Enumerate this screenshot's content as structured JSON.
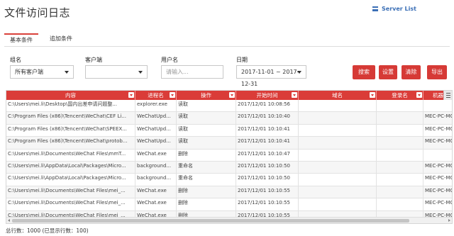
{
  "page": {
    "title": "文件访问日志",
    "server_list": "Server List"
  },
  "tabs": [
    {
      "label": "基本条件"
    },
    {
      "label": "追加条件"
    }
  ],
  "filters": {
    "group": {
      "label": "组名",
      "value": "所有客户端"
    },
    "client": {
      "label": "客户端",
      "value": ""
    },
    "user": {
      "label": "用户名",
      "placeholder": "请输入..."
    },
    "date": {
      "label": "日期",
      "value": "2017-11-01 ~ 2017-12-31"
    }
  },
  "buttons": {
    "search": "搜索",
    "settings": "设置",
    "clear": "清除",
    "export": "导出"
  },
  "table": {
    "columns": [
      "内容",
      "进程名",
      "操作",
      "开始时间",
      "域名",
      "登录名",
      "机器"
    ],
    "rows": [
      [
        "C:\\Users\\mei.li\\Desktop\\国内出差申请问题整...",
        "explorer.exe",
        "读取",
        "2017/12/01 10:08:56",
        "",
        "",
        ""
      ],
      [
        "C:\\Program Files (x86)\\Tencent\\WeChat\\CEF Li...",
        "WeChatUpd...",
        "读取",
        "2017/12/01 10:10:40",
        "",
        "",
        "MEC-PC-MC"
      ],
      [
        "C:\\Program Files (x86)\\Tencent\\WeChat\\SPEEX...",
        "WeChatUpd...",
        "读取",
        "2017/12/01 10:10:41",
        "",
        "",
        "MEC-PC-MC"
      ],
      [
        "C:\\Program Files (x86)\\Tencent\\WeChat\\protob...",
        "WeChatUpd...",
        "读取",
        "2017/12/01 10:10:41",
        "",
        "",
        "MEC-PC-MC"
      ],
      [
        "C:\\Users\\mei.li\\Documents\\WeChat Files\\mmT...",
        "WeChat.exe",
        "删除",
        "2017/12/01 10:10:47",
        "",
        "",
        ""
      ],
      [
        "C:\\Users\\mei.li\\AppData\\Local\\Packages\\Micro...",
        "background...",
        "重命名",
        "2017/12/01 10:10:50",
        "",
        "",
        "MEC-PC-MC"
      ],
      [
        "C:\\Users\\mei.li\\AppData\\Local\\Packages\\Micro...",
        "background...",
        "重命名",
        "2017/12/01 10:10:50",
        "",
        "",
        "MEC-PC-MC"
      ],
      [
        "C:\\Users\\mei.li\\Documents\\WeChat Files\\mei_...",
        "WeChat.exe",
        "删除",
        "2017/12/01 10:10:55",
        "",
        "",
        "MEC-PC-MC"
      ],
      [
        "C:\\Users\\mei.li\\Documents\\WeChat Files\\mei_...",
        "WeChat.exe",
        "删除",
        "2017/12/01 10:10:55",
        "",
        "",
        "MEC-PC-MC"
      ],
      [
        "C:\\Users\\mei.li\\Documents\\WeChat Files\\mei_...",
        "WeChat.exe",
        "删除",
        "2017/12/01 10:10:55",
        "",
        "",
        "MEC-PC-MC"
      ]
    ]
  },
  "footer": {
    "total": "总行数：1000 (已显示行数：100)"
  }
}
